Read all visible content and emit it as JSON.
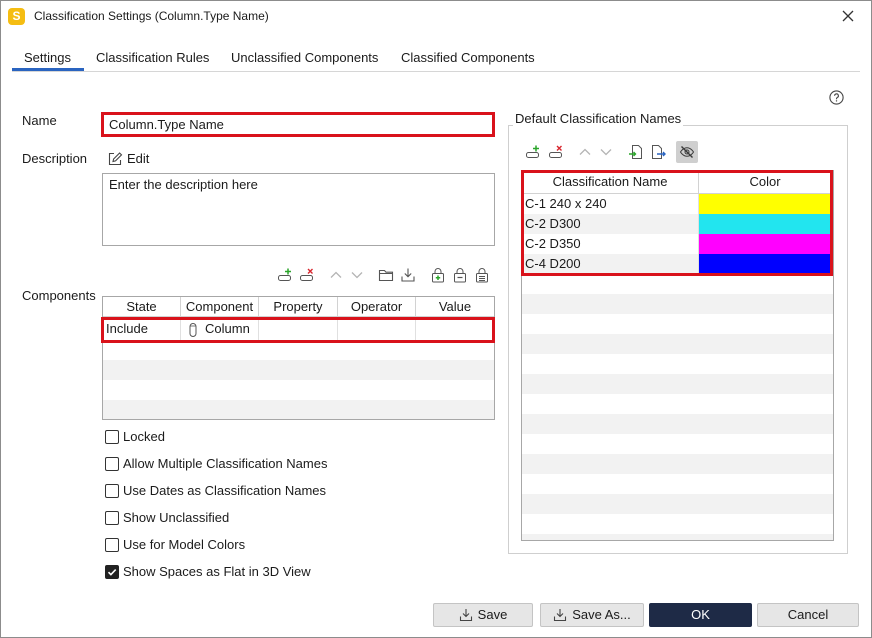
{
  "window": {
    "title": "Classification Settings (Column.Type Name)",
    "app_icon_letter": "S"
  },
  "tabs": [
    {
      "label": "Settings",
      "active": true
    },
    {
      "label": "Classification Rules",
      "active": false
    },
    {
      "label": "Unclassified Components",
      "active": false
    },
    {
      "label": "Classified Components",
      "active": false
    }
  ],
  "settings": {
    "name_label": "Name",
    "name_value": "Column.Type Name",
    "description_label": "Description",
    "edit_label": "Edit",
    "description_placeholder": "Enter the description here",
    "components_label": "Components"
  },
  "components_toolbar": [
    {
      "icon": "add-row-icon"
    },
    {
      "icon": "remove-row-icon"
    },
    {
      "icon": "move-up-icon",
      "enabled": false
    },
    {
      "icon": "move-down-icon",
      "enabled": false
    },
    {
      "icon": "open-folder-icon"
    },
    {
      "icon": "download-icon"
    },
    {
      "icon": "lock-add-icon"
    },
    {
      "icon": "lock-icon"
    },
    {
      "icon": "lock-list-icon"
    }
  ],
  "components_table": {
    "columns": [
      "State",
      "Component",
      "Property",
      "Operator",
      "Value"
    ],
    "rows": [
      {
        "state": "Include",
        "component": "Column",
        "component_icon": "column-icon",
        "property": "",
        "operator": "",
        "value": ""
      }
    ]
  },
  "options": [
    {
      "label": "Locked",
      "checked": false
    },
    {
      "label": "Allow Multiple Classification Names",
      "checked": false
    },
    {
      "label": "Use Dates as Classification Names",
      "checked": false
    },
    {
      "label": "Show Unclassified",
      "checked": false
    },
    {
      "label": "Use for Model Colors",
      "checked": false
    },
    {
      "label": "Show Spaces as Flat in 3D View",
      "checked": true
    }
  ],
  "default_names": {
    "title": "Default Classification Names",
    "toolbar": [
      {
        "icon": "add-row-icon"
      },
      {
        "icon": "remove-row-icon"
      },
      {
        "icon": "move-up-icon",
        "enabled": false
      },
      {
        "icon": "move-down-icon",
        "enabled": false
      },
      {
        "icon": "import-icon"
      },
      {
        "icon": "export-icon"
      },
      {
        "icon": "hide-icon",
        "active": true
      }
    ],
    "columns": [
      "Classification Name",
      "Color"
    ],
    "rows": [
      {
        "name": "C-1 240 x 240",
        "color": "#ffff00"
      },
      {
        "name": "C-2 D300",
        "color": "#22e5ef"
      },
      {
        "name": "C-2 D350",
        "color": "#ff00ff"
      },
      {
        "name": "C-4 D200",
        "color": "#0000ff"
      }
    ]
  },
  "footer": {
    "save_label": "Save",
    "save_as_label": "Save As...",
    "ok_label": "OK",
    "cancel_label": "Cancel"
  },
  "colors": {
    "accent": "#2a64c0",
    "highlight_border": "#d9121b",
    "ok_button": "#1e2a46",
    "app_icon": "#f5bd12"
  }
}
